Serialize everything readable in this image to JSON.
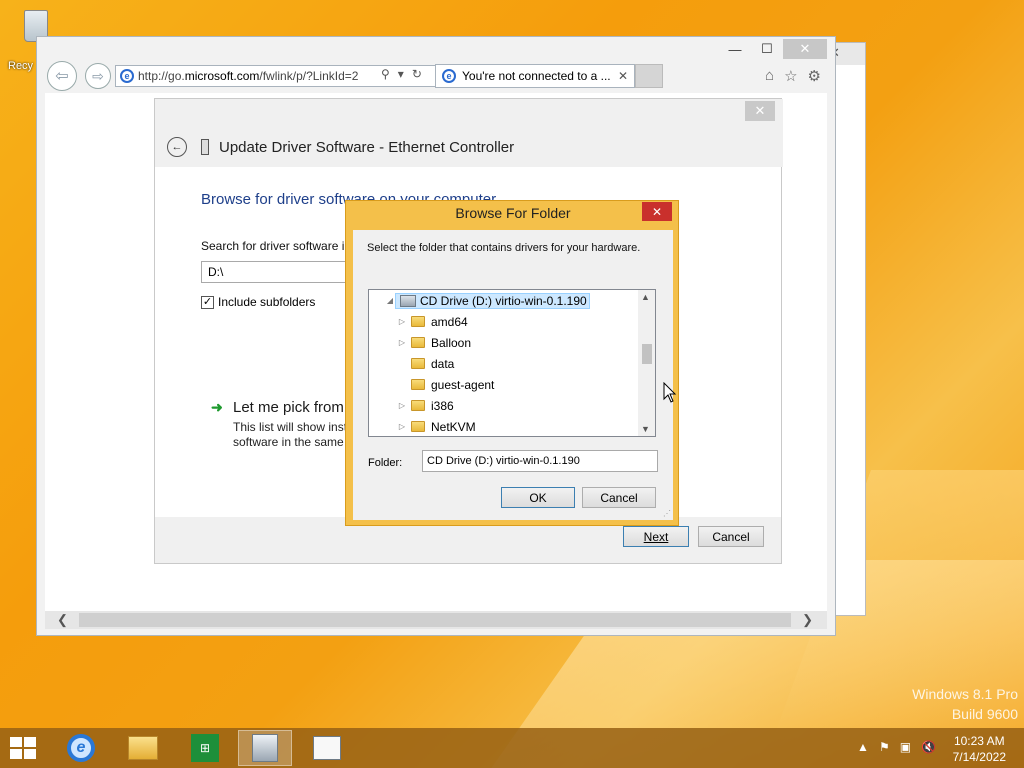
{
  "desktop": {
    "recycle_bin_label": "Recy",
    "watermark_line1": "Windows 8.1 Pro",
    "watermark_line2": "Build 9600"
  },
  "browser": {
    "address_prefix": "http://go.",
    "address_domain": "microsoft.com",
    "address_suffix": "/fwlink/p/?LinkId=2",
    "tab_title": "You're not connected to a ...",
    "tab_close": "✕",
    "window_close": "✕",
    "window_max": "☐",
    "window_min": "—"
  },
  "wizard": {
    "title": "Update Driver Software - Ethernet Controller",
    "heading": "Browse for driver software on your computer",
    "search_label": "Search for driver software in this location:",
    "path_value": "D:\\",
    "include_subfolders_label": "Include subfolders",
    "include_subfolders_checked": true,
    "pick_link": "Let me pick from",
    "pick_desc": "This list will show inst software in the same",
    "next_label": "Next",
    "cancel_label": "Cancel",
    "close": "✕"
  },
  "browse_dialog": {
    "title": "Browse For Folder",
    "close": "✕",
    "instruction": "Select the folder that contains drivers for your hardware.",
    "tree": [
      {
        "label": "CD Drive (D:) virtio-win-0.1.190",
        "level": 0,
        "expander": "expanded",
        "icon": "drive-icon",
        "selected": true
      },
      {
        "label": "amd64",
        "level": 1,
        "expander": "collapsed",
        "icon": "folder-icon",
        "selected": false
      },
      {
        "label": "Balloon",
        "level": 1,
        "expander": "collapsed",
        "icon": "folder-icon",
        "selected": false
      },
      {
        "label": "data",
        "level": 1,
        "expander": "none",
        "icon": "folder-icon",
        "selected": false
      },
      {
        "label": "guest-agent",
        "level": 1,
        "expander": "none",
        "icon": "folder-icon",
        "selected": false
      },
      {
        "label": "i386",
        "level": 1,
        "expander": "collapsed",
        "icon": "folder-icon",
        "selected": false
      },
      {
        "label": "NetKVM",
        "level": 1,
        "expander": "collapsed",
        "icon": "folder-icon",
        "selected": false
      }
    ],
    "folder_label": "Folder:",
    "folder_value": "CD Drive (D:) virtio-win-0.1.190",
    "ok_label": "OK",
    "cancel_label": "Cancel"
  },
  "taskbar": {
    "time": "10:23 AM",
    "date": "7/14/2022",
    "apps": [
      "internet-explorer-icon",
      "file-explorer-icon",
      "store-icon",
      "device-manager-icon",
      "document-icon"
    ]
  },
  "colors": {
    "dialog_frame": "#f4c04a",
    "close_red": "#c9302c",
    "heading_blue": "#1e3f8a",
    "selection": "#cde8ff"
  }
}
